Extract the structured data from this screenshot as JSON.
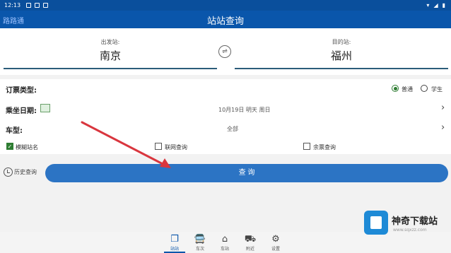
{
  "status_bar": {
    "time": "12:13"
  },
  "app_bar": {
    "brand": "路路通",
    "title": "站站查询"
  },
  "stations": {
    "from_label": "出发站:",
    "from_value": "南京",
    "to_label": "目的站:",
    "to_value": "福州",
    "swap_icon": "swap-icon"
  },
  "ticket_type": {
    "label": "订票类型:",
    "options": [
      "普通",
      "学生"
    ],
    "selected": "普通"
  },
  "date": {
    "label": "乘坐日期:",
    "value": "10月19日 明天 周日"
  },
  "train_type": {
    "label": "车型:",
    "value": "全部"
  },
  "options": {
    "fuzzy": "模糊站名",
    "network": "联网查询",
    "remaining": "余票查询",
    "fuzzy_checked": true
  },
  "history": {
    "label": "历史查询"
  },
  "query_button": {
    "label": "查 询"
  },
  "bottom_nav": [
    {
      "label": "站站",
      "icon": "copy-icon",
      "active": true
    },
    {
      "label": "车次",
      "icon": "train-icon"
    },
    {
      "label": "车站",
      "icon": "home-icon"
    },
    {
      "label": "附近",
      "icon": "cart-icon"
    },
    {
      "label": "设置",
      "icon": "gear-icon"
    }
  ],
  "watermark": {
    "name": "神奇下载站",
    "url": "www.sqxzz.com"
  },
  "colors": {
    "primary": "#0a56ab",
    "button": "#2c74c4",
    "accent_green": "#2e7d32",
    "annotation_arrow": "#d9363e"
  }
}
